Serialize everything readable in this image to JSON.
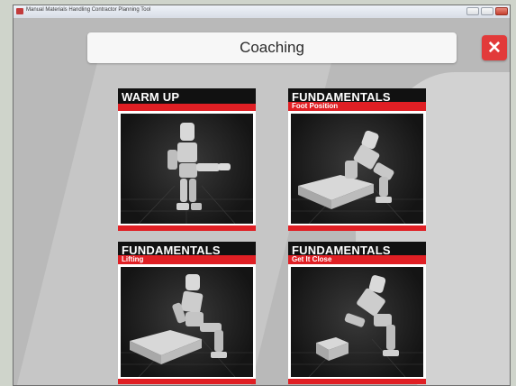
{
  "window": {
    "title": "Manual Materials Handling Contractor Planning Tool"
  },
  "header": {
    "title": "Coaching"
  },
  "cards": [
    {
      "title": "WARM UP",
      "subtitle": ""
    },
    {
      "title": "FUNDAMENTALS",
      "subtitle": "Foot Position"
    },
    {
      "title": "FUNDAMENTALS",
      "subtitle": "Lifting"
    },
    {
      "title": "FUNDAMENTALS",
      "subtitle": "Get It Close"
    }
  ],
  "colors": {
    "accent": "#e01f24",
    "header_bg": "#111111",
    "close_bg": "#e23a3a"
  }
}
